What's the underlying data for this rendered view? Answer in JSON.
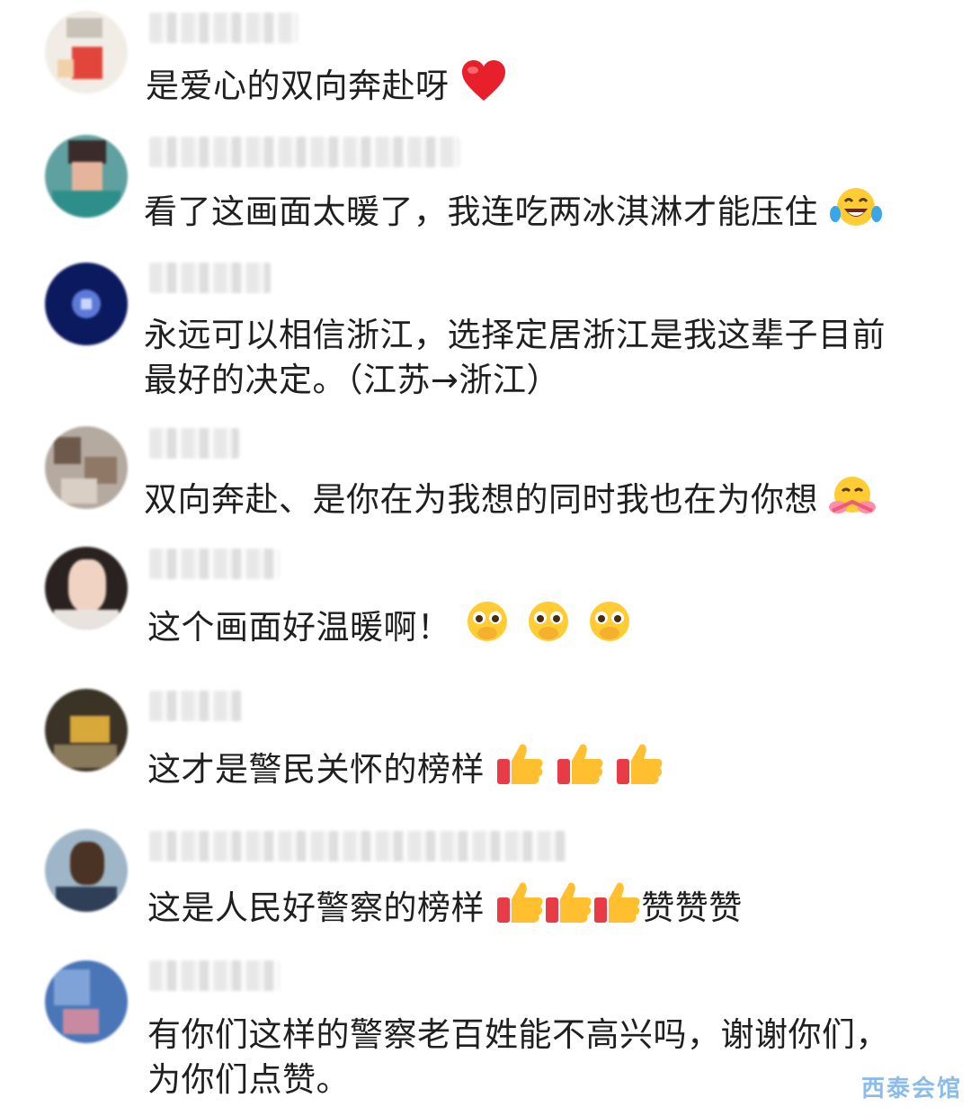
{
  "comments": [
    {
      "text": "是爱心的双向奔赴呀",
      "emoji": "red-heart"
    },
    {
      "text": "看了这画面太暖了，我连吃两冰淇淋才能压住",
      "emoji": "tears-of-joy"
    },
    {
      "line1": "永远可以相信浙江，选择定居浙江是我这辈子目前",
      "line2": "最好的决定。（江苏→浙江）"
    },
    {
      "text": "双向奔赴、是你在为我想的同时我也在为你想",
      "emoji": "hugging-face"
    },
    {
      "text": "这个画面好温暖啊！",
      "emoji": "pleading-face"
    },
    {
      "text": "这才是警民关怀的榜样",
      "emoji": "thumbs-up"
    },
    {
      "text": "这是人民好警察的榜样",
      "suffix": "赞赞赞",
      "emoji": "thumbs-up"
    },
    {
      "line1": "有你们这样的警察老百姓能不高兴吗，谢谢你们，",
      "line2": "为你们点赞。"
    }
  ],
  "watermark": "西泰会馆"
}
